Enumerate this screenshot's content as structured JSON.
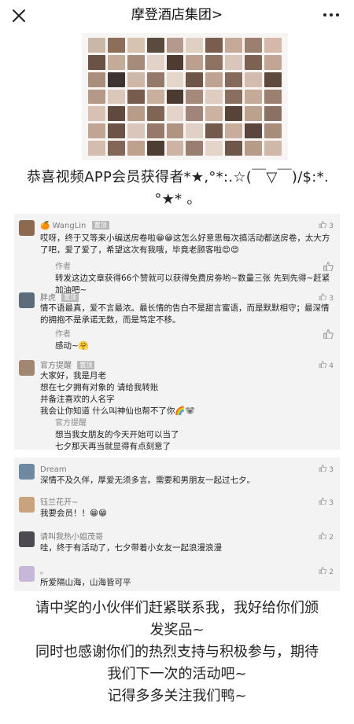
{
  "nav": {
    "close_icon": "close-icon",
    "title": "摩登酒店集团",
    "chevron": ">",
    "more_icon": "more-dots-icon"
  },
  "photo_grid": {
    "colors": [
      "#c9b8a8",
      "#8d6e5a",
      "#d8c2b0",
      "#5b4a3e",
      "#b49a8c",
      "#e0cfc3",
      "#7a5d4f",
      "#c7a99a",
      "#9b7f6f",
      "#d6b8aa",
      "#6a5247",
      "#c4ab9a",
      "#a58b7a",
      "#e2d2c8",
      "#4e3c33",
      "#bba08f",
      "#8e7262",
      "#d9c5b9",
      "#7d6253",
      "#c2a594",
      "#aa8e7c",
      "#3f3330",
      "#cfb7a7",
      "#94786a",
      "#e5d6cc",
      "#6f5548",
      "#bfa392",
      "#85695a",
      "#d3bcae",
      "#5f483d",
      "#b59988",
      "#dcc8bb",
      "#785d4e",
      "#c9af9e",
      "#4a3a32",
      "#a68a79",
      "#e0cdc1",
      "#8a6f60",
      "#c6aa98",
      "#9c7f6e",
      "#d8c1b2",
      "#604a3f",
      "#b89c8a",
      "#7f6556",
      "#e3d3c9",
      "#a1857a",
      "#cbb2a1",
      "#574338",
      "#bda18f",
      "#8b7064",
      "#c1a493",
      "#6c5348",
      "#dac6ba",
      "#96796a",
      "#b09381",
      "#e1d0c5",
      "#735a4c",
      "#c8ad9c",
      "#5a463c",
      "#a98d7b",
      "#d4bdaf",
      "#826758",
      "#bea290",
      "#4d3d35",
      "#ccb3a3",
      "#9a7e6f",
      "#e4d4ca",
      "#6e5649",
      "#b79b89",
      "#d0b8a9"
    ]
  },
  "headline": {
    "line1": "恭喜视频APP会员获得者*★,°*:.☆(￣▽￣)/$:*.",
    "line2": "°★* 。"
  },
  "comments_panel_1": [
    {
      "name": "WangLin",
      "name_emoji": "🍊",
      "tag": "置顶",
      "likes": "3",
      "text": "哎呀，终于又等来小编送房卷啦😁😁这怎么好意思每次搞活动都送房卷，太大方了吧，爱了爱了，希望这次有我哦，毕竟老顾客啦😍😍",
      "reply_label": "作者",
      "reply_text": "转发这边文章获得66个赞就可以获得免费房劵哟~数量三张 先到先得~赶紧加油吧~"
    },
    {
      "name": "胖虎",
      "tag": "置顶",
      "likes": "3",
      "text": "情不语最真，爱不言最浓。最长情的告白不是甜言蜜语，而是默默相守；最深情的拥抱不是承诺无数，而是笃定不移。",
      "reply_label": "作者",
      "reply_text": "感动~🤗"
    },
    {
      "name": "官方提醒",
      "tag": "置顶",
      "likes": "4",
      "text_lines": [
        "大家好，我是月老",
        "想在七夕拥有对象的  请给我转账",
        "并备注喜欢的人名字",
        "我会让你知道  什么叫神仙也帮不了你🌈🐨"
      ],
      "reply_label": "官方提醒",
      "reply_lines": [
        "想当我女朋友的今天开始可以当了",
        "七夕那天再当就显得有点刻意了"
      ]
    }
  ],
  "comments_panel_2": [
    {
      "name": "Dream",
      "likes": "3",
      "text": "深情不及久伴，厚爱无须多言。需要和男朋友一起过七夕。"
    },
    {
      "name": "钰兰花开~",
      "likes": "3",
      "text": "我要会员！！😁😁"
    },
    {
      "name": "请叫我热小姐茂哥",
      "likes": "2",
      "text": "哇，终于有活动了，七夕带着小女友一起浪漫浪漫"
    },
    {
      "name": "。",
      "likes": "2",
      "text": "所爱隔山海，山海皆可平"
    }
  ],
  "closing": {
    "line1": "请中奖的小伙伴们赶紧联系我，我好给你们颁",
    "line2": "发奖品~",
    "line3": "同时也感谢你们的热烈支持与积极参与，期待",
    "line4": "我们下一次的活动吧~",
    "line5": "记得多多关注我们鸭~"
  },
  "colors": {
    "panel_bg": "#f3f3f3",
    "tag_bg": "#b8b8b8",
    "meta_text": "#7a7a7a"
  }
}
